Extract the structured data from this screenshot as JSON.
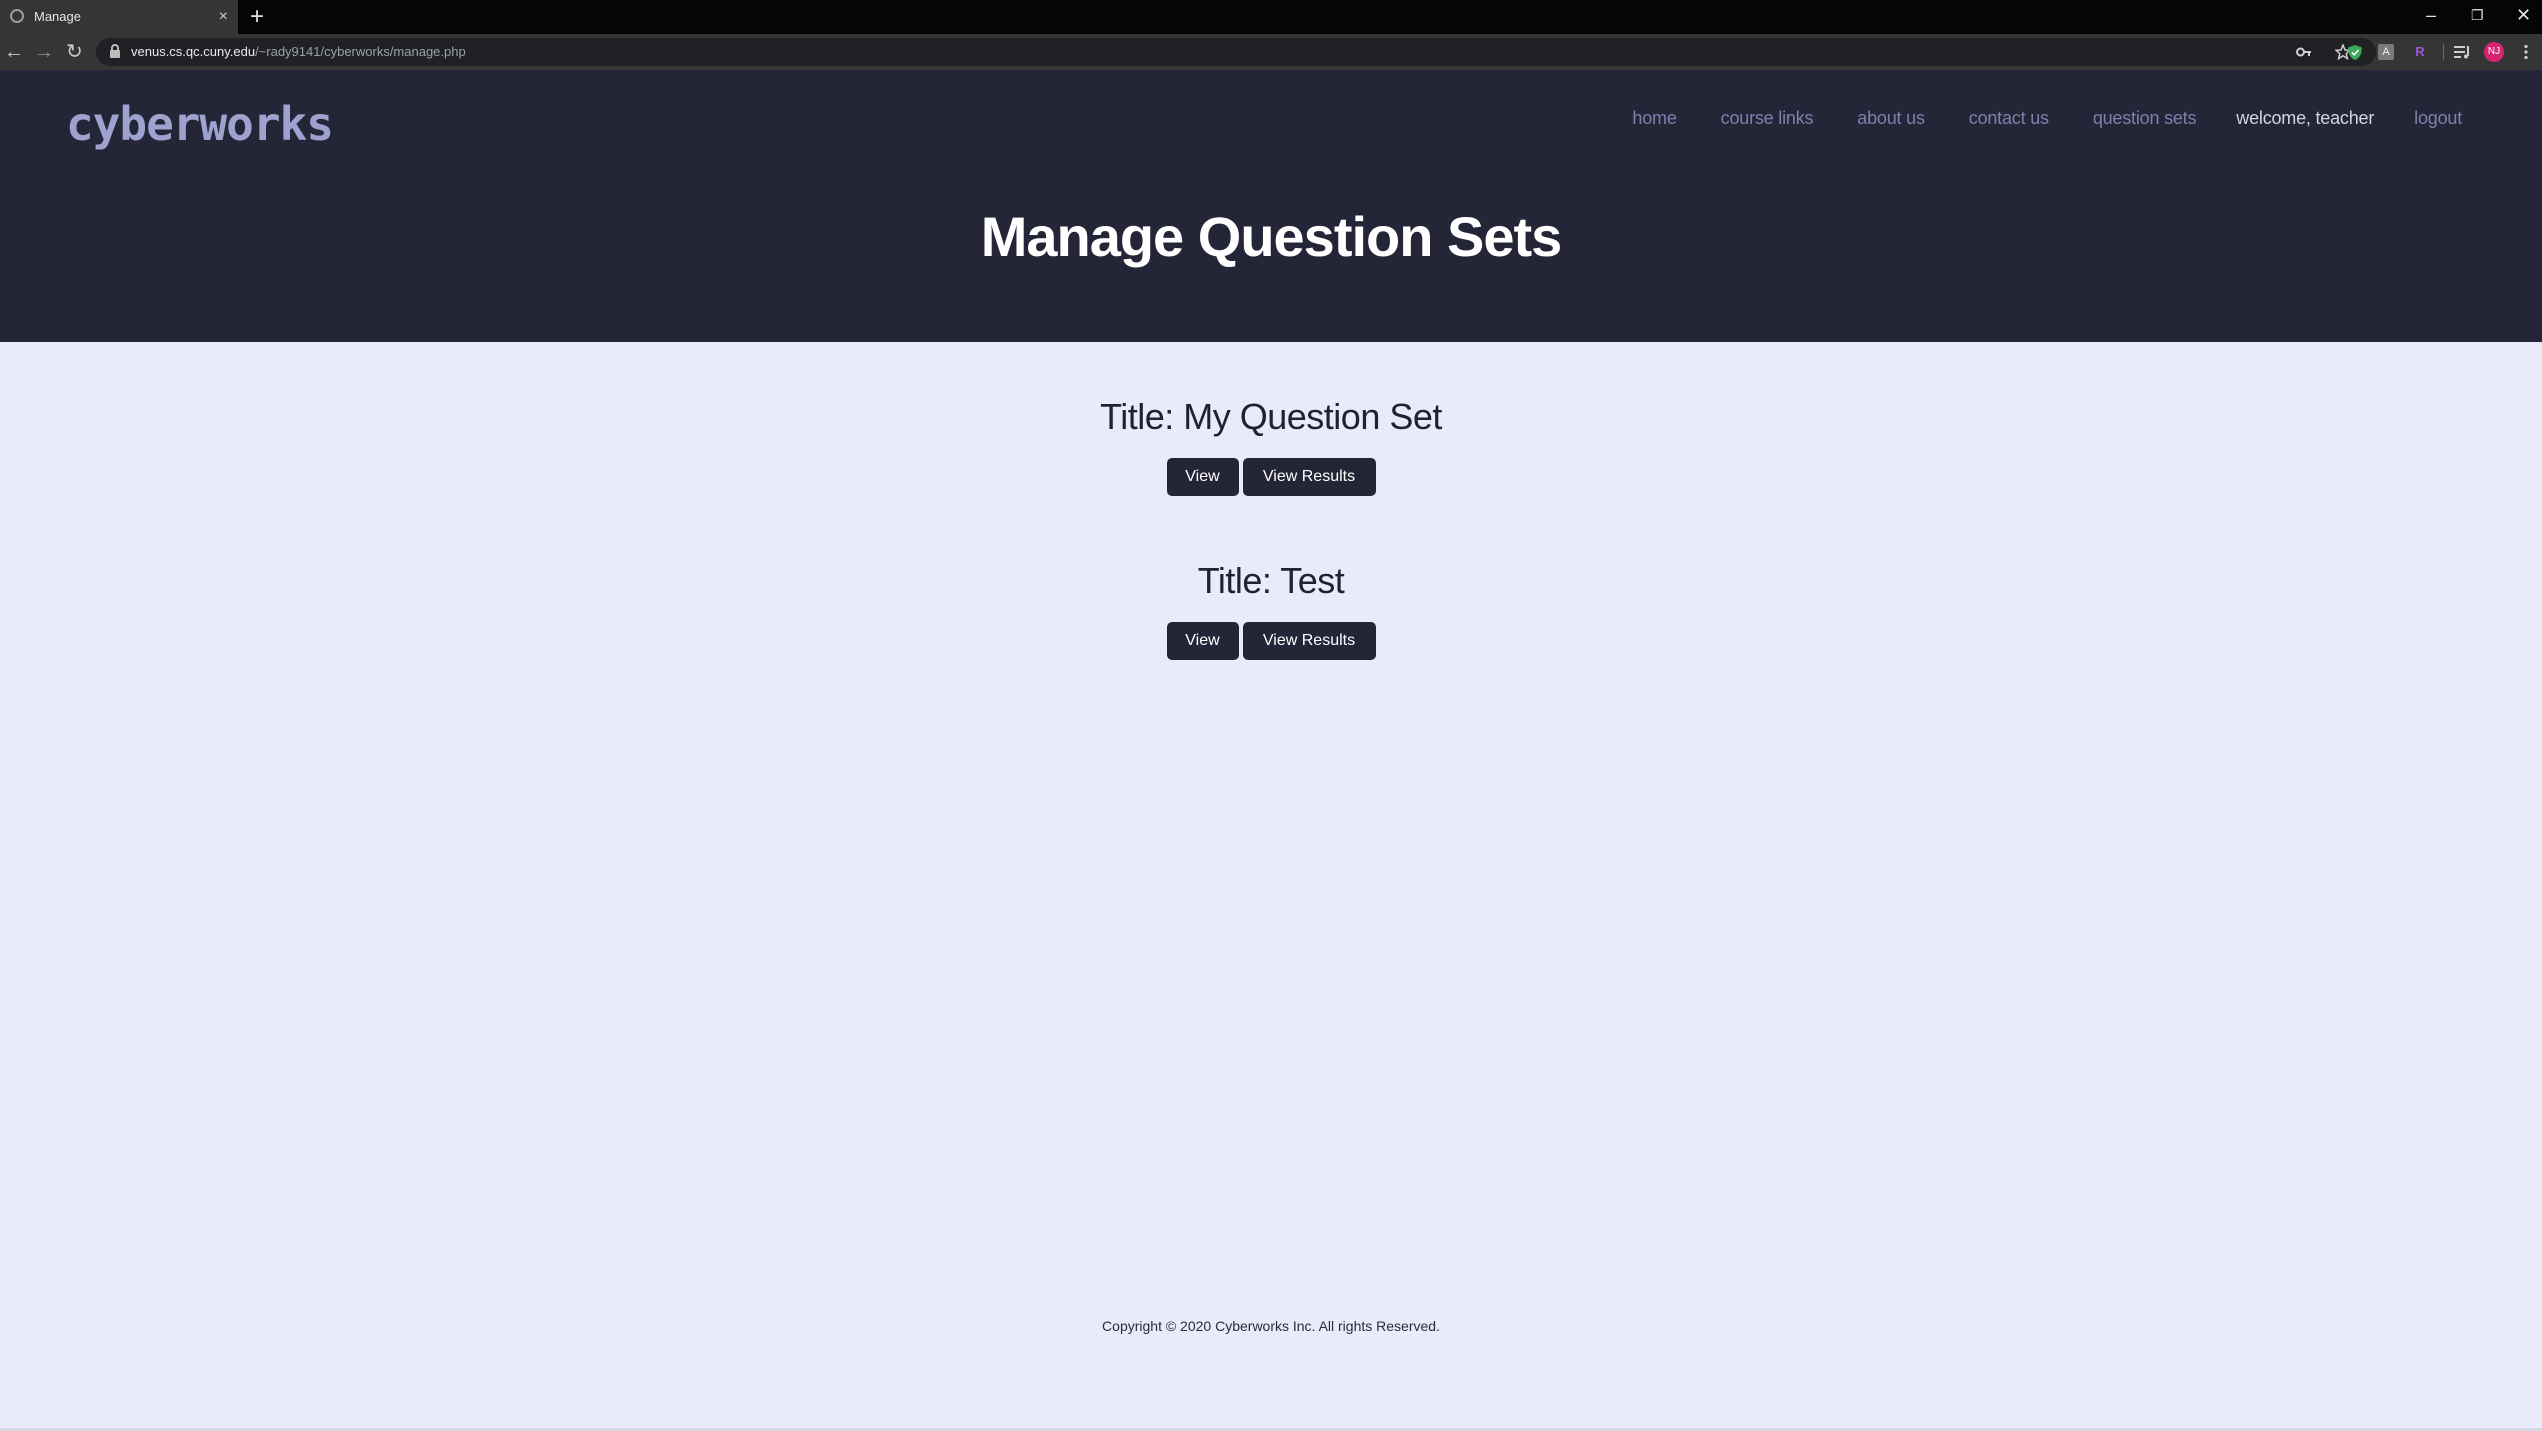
{
  "browser": {
    "tab_title": "Manage",
    "tab_close": "×",
    "new_tab": "+",
    "url_host": "venus.cs.qc.cuny.edu",
    "url_path": "/~rady9141/cyberworks/manage.php",
    "avatar_initials": "NJ",
    "window_controls": {
      "minimize": "–",
      "restore": "❐",
      "close": "✕"
    },
    "nav": {
      "back": "←",
      "forward": "→",
      "reload": "↻"
    },
    "icons": [
      "key-icon",
      "star-icon",
      "shield-extension-icon",
      "extension-a-icon",
      "extension-r-icon",
      "media-queue-icon",
      "avatar",
      "kebab-menu-icon"
    ]
  },
  "site": {
    "logo_text": "cyberworks",
    "nav": {
      "home": "home",
      "course_links": "course links",
      "about_us": "about us",
      "contact_us": "contact us",
      "question_sets": "question sets",
      "welcome": "welcome, teacher",
      "logout": "logout"
    },
    "page_title": "Manage Question Sets"
  },
  "question_sets": [
    {
      "title": "Title: My Question Set",
      "view_label": "View",
      "results_label": "View Results"
    },
    {
      "title": "Title: Test",
      "view_label": "View",
      "results_label": "View Results"
    }
  ],
  "footer": {
    "copyright": "Copyright © 2020 Cyberworks Inc. All rights Reserved."
  },
  "colors": {
    "header_bg": "#242638",
    "page_bg": "#e9ebfb",
    "nav_link": "#7c80ad",
    "button_bg": "#242638",
    "logo_fill": "#9ea2cf"
  }
}
